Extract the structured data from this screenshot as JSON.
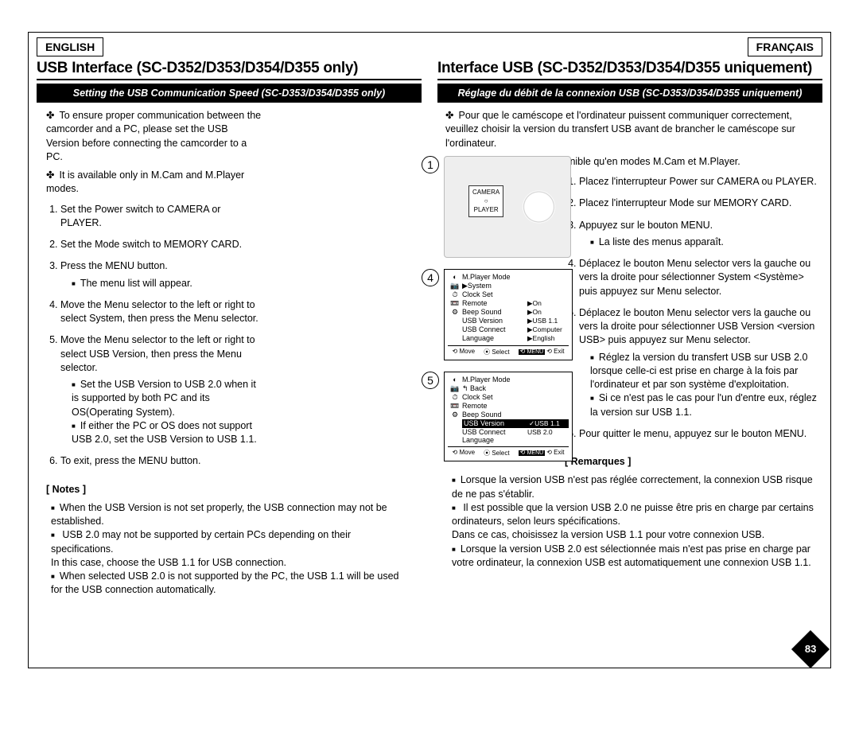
{
  "page_number": "83",
  "english": {
    "lang": "ENGLISH",
    "title": "USB Interface (SC-D352/D353/D354/D355 only)",
    "section": "Setting the USB Communication Speed (SC-D353/D354/D355 only)",
    "intro1": "To ensure proper communication between the camcorder and a PC, please set the USB Version before connecting the camcorder to a PC.",
    "intro2": "It is available only in M.Cam and M.Player modes.",
    "steps": {
      "s1": "Set the Power switch to CAMERA or PLAYER.",
      "s2": "Set the Mode switch to MEMORY CARD.",
      "s3": "Press the MENU button.",
      "s3sub": "The menu list will appear.",
      "s4": "Move the Menu selector to the left or right to select System, then press the Menu selector.",
      "s5": "Move the Menu selector to the left or right to select USB Version, then press the Menu selector.",
      "s5suba": "Set the USB Version to USB 2.0 when it is supported by both PC and its OS(Operating System).",
      "s5subb": "If either the PC or OS does not support USB 2.0, set the USB Version to USB 1.1.",
      "s6": "To exit, press the MENU button."
    },
    "notes_head": "[ Notes ]",
    "notes": {
      "n1": "When the USB Version is not set properly, the USB connection may not be established.",
      "n2": "USB 2.0 may not be supported by certain PCs depending on their specifications.",
      "n2b": "In this case, choose the USB 1.1 for USB connection.",
      "n3": "When selected USB 2.0 is not supported by the PC, the USB 1.1 will be used for the USB connection automatically."
    }
  },
  "french": {
    "lang": "FRANÇAIS",
    "title": "Interface USB (SC-D352/D353/D354/D355 uniquement)",
    "section": "Réglage du débit de la connexion USB (SC-D353/D354/D355 uniquement)",
    "intro1": "Pour que le caméscope et l'ordinateur puissent communiquer correctement, veuillez choisir la version du transfert USB avant de brancher le caméscope sur l'ordinateur.",
    "intro2": "Cette fonction n'est disponible qu'en modes M.Cam et M.Player.",
    "steps": {
      "s1": "Placez l'interrupteur Power sur CAMERA ou PLAYER.",
      "s2": "Placez l'interrupteur Mode sur MEMORY CARD.",
      "s3": "Appuyez sur le bouton MENU.",
      "s3sub": "La liste des menus apparaît.",
      "s4": "Déplacez le bouton Menu selector vers la gauche ou vers la droite pour sélectionner System <Système> puis appuyez sur Menu selector.",
      "s5": "Déplacez le bouton Menu selector vers la gauche ou vers la droite pour sélectionner USB Version <version USB> puis appuyez sur Menu selector.",
      "s5suba": "Réglez la version du transfert USB sur USB 2.0 lorsque celle-ci est prise en charge à la fois par l'ordinateur et par son système d'exploitation.",
      "s5subb": "Si ce n'est pas le cas pour l'un d'entre eux, réglez la version sur USB 1.1.",
      "s6": "Pour quitter le menu, appuyez sur le bouton MENU."
    },
    "notes_head": "[ Remarques ]",
    "notes": {
      "n1": "Lorsque la version USB n'est pas réglée correctement, la connexion USB risque de ne pas s'établir.",
      "n2": "Il est possible que la version USB 2.0 ne puisse être pris en charge par certains ordinateurs, selon leurs spécifications.",
      "n2b": "Dans ce cas, choisissez la version USB 1.1 pour votre connexion USB.",
      "n3": "Lorsque la version USB 2.0 est sélectionnée mais n'est pas prise en charge par votre ordinateur, la connexion USB est automatiquement une connexion USB 1.1."
    }
  },
  "figures": {
    "cam": {
      "label_top": "CAMERA",
      "label_bot": "PLAYER"
    },
    "menu4": {
      "title": "M.Player Mode",
      "rows": [
        {
          "icon": "📷",
          "t": "▶System",
          "v": ""
        },
        {
          "icon": "⏱",
          "t": "Clock Set",
          "v": ""
        },
        {
          "icon": "📼",
          "t": "Remote",
          "v": "▶On"
        },
        {
          "icon": "⚙",
          "t": "Beep Sound",
          "v": "▶On"
        },
        {
          "icon": "",
          "t": "USB Version",
          "v": "▶USB 1.1"
        },
        {
          "icon": "",
          "t": "USB Connect",
          "v": "▶Computer"
        },
        {
          "icon": "",
          "t": "Language",
          "v": "▶English"
        }
      ],
      "footer": {
        "move": "Move",
        "select": "Select",
        "exit": "Exit",
        "menu": "MENU"
      }
    },
    "menu5": {
      "title": "M.Player Mode",
      "back": "↰ Back",
      "rows": [
        {
          "icon": "📷",
          "t": "Clock Set",
          "v": ""
        },
        {
          "icon": "⏱",
          "t": "Remote",
          "v": ""
        },
        {
          "icon": "📼",
          "t": "Beep Sound",
          "v": ""
        },
        {
          "icon": "⚙",
          "t": "USB Version",
          "v": "✓USB 1.1",
          "hl": true
        },
        {
          "icon": "",
          "t": "USB Connect",
          "v": "USB 2.0"
        },
        {
          "icon": "",
          "t": "Language",
          "v": ""
        }
      ],
      "footer": {
        "move": "Move",
        "select": "Select",
        "exit": "Exit",
        "menu": "MENU"
      }
    }
  }
}
